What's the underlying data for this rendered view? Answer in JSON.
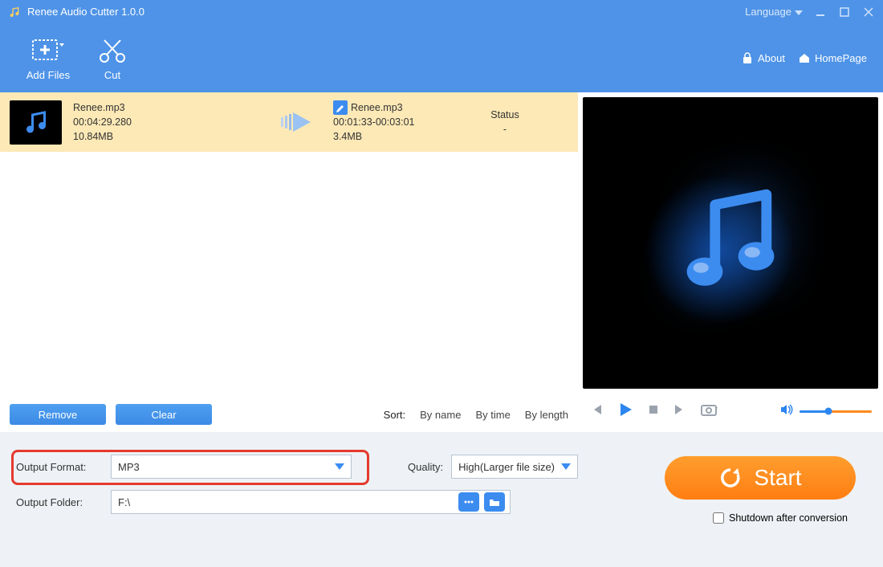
{
  "app": {
    "title": "Renee Audio Cutter 1.0.0"
  },
  "titlebar": {
    "language": "Language"
  },
  "toolbar": {
    "add_files": "Add Files",
    "cut": "Cut",
    "about": "About",
    "homepage": "HomePage"
  },
  "file": {
    "source": {
      "name": "Renee.mp3",
      "duration": "00:04:29.280",
      "size": "10.84MB"
    },
    "output": {
      "name": "Renee.mp3",
      "range": "00:01:33-00:03:01",
      "size": "3.4MB"
    },
    "status_label": "Status",
    "status_value": "-"
  },
  "buttons": {
    "remove": "Remove",
    "clear": "Clear"
  },
  "sort": {
    "label": "Sort:",
    "by_name": "By name",
    "by_time": "By time",
    "by_length": "By length"
  },
  "form": {
    "output_format_label": "Output Format:",
    "output_format_value": "MP3",
    "quality_label": "Quality:",
    "quality_value": "High(Larger file size)",
    "output_folder_label": "Output Folder:",
    "output_folder_value": "F:\\"
  },
  "start": "Start",
  "shutdown_label": "Shutdown after conversion"
}
